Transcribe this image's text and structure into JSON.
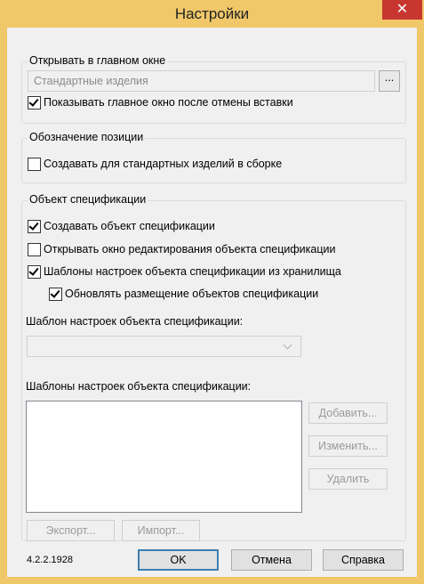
{
  "window": {
    "title": "Настройки",
    "close_glyph": "✕"
  },
  "main_window_group": {
    "legend": "Открывать в главном окне",
    "field_value": "Стандартные изделия",
    "browse_label": "...",
    "show_after_cancel": {
      "label": "Показывать главное окно после отмены вставки",
      "checked": true
    }
  },
  "position_group": {
    "legend": "Обозначение позиции",
    "create_for_std": {
      "label": "Создавать для стандартных изделий в сборке",
      "checked": false
    }
  },
  "spec_group": {
    "legend": "Объект спецификации",
    "create_obj": {
      "label": "Создавать объект спецификации",
      "checked": true
    },
    "open_edit": {
      "label": "Открывать окно редактирования объекта спецификации",
      "checked": false
    },
    "templates_from_storage": {
      "label": "Шаблоны настроек объекта спецификации из хранилища",
      "checked": true
    },
    "update_placement": {
      "label": "Обновлять размещение объектов спецификации",
      "checked": true
    },
    "template_label": "Шаблон настроек объекта спецификации:",
    "template_value": "",
    "templates_list_label": "Шаблоны настроек объекта спецификации:",
    "templates_list": [],
    "add_label": "Добавить...",
    "edit_label": "Изменить...",
    "delete_label": "Удалить",
    "export_label": "Экспорт...",
    "import_label": "Импорт..."
  },
  "footer": {
    "version": "4.2.2.1928",
    "ok_label": "OK",
    "cancel_label": "Отмена",
    "help_label": "Справка"
  },
  "colors": {
    "title_bar": "#f0c86a",
    "close_button": "#c7372f",
    "client": "#f0f0f0"
  }
}
